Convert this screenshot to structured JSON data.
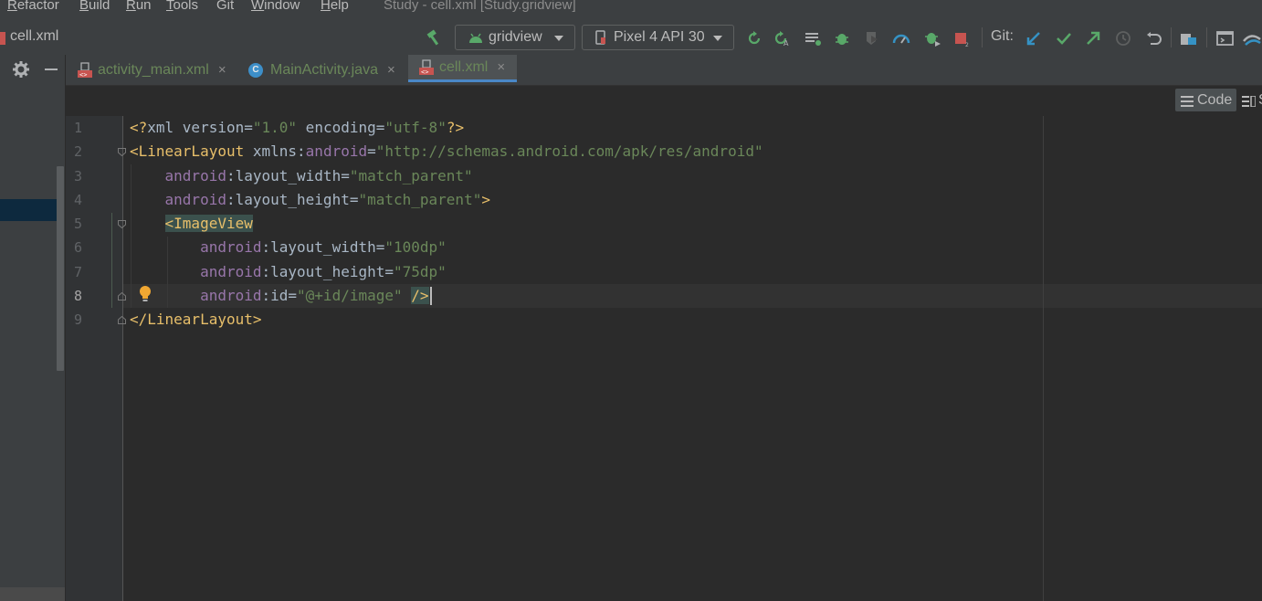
{
  "menu": {
    "items": [
      {
        "underline": "R",
        "rest": "efactor"
      },
      {
        "underline": "B",
        "rest": "uild"
      },
      {
        "underline": "R",
        "rest": "un"
      },
      {
        "underline": "T",
        "rest": "ools"
      },
      {
        "underline": "",
        "rest": "Git"
      },
      {
        "underline": "W",
        "rest": "indow"
      },
      {
        "underline": "H",
        "rest": "elp"
      }
    ],
    "window_title": "Study - cell.xml [Study.gridview]"
  },
  "toolbar": {
    "breadcrumb": "cell.xml",
    "run_config": "gridview",
    "device": "Pixel 4 API 30",
    "git_label": "Git:"
  },
  "tabs": [
    {
      "label": "activity_main.xml",
      "type": "xml",
      "active": false,
      "close": "×"
    },
    {
      "label": "MainActivity.java",
      "type": "java",
      "active": false,
      "close": "×"
    },
    {
      "label": "cell.xml",
      "type": "xml",
      "active": true,
      "close": "×"
    }
  ],
  "view_modes": {
    "code": "Code",
    "split": "S"
  },
  "editor": {
    "line_numbers": [
      "1",
      "2",
      "3",
      "4",
      "5",
      "6",
      "7",
      "8",
      "9"
    ],
    "current_line": 8,
    "lines": [
      [
        [
          "t-tag",
          "<?"
        ],
        [
          "t-plain",
          "xml version"
        ],
        [
          "t-plain",
          "="
        ],
        [
          "t-val",
          "\"1.0\""
        ],
        [
          "t-plain",
          " encoding"
        ],
        [
          "t-plain",
          "="
        ],
        [
          "t-val",
          "\"utf-8\""
        ],
        [
          "t-tag",
          "?>"
        ]
      ],
      [
        [
          "t-tag",
          "<LinearLayout"
        ],
        [
          "t-plain",
          " xmlns"
        ],
        [
          "t-plain",
          ":"
        ],
        [
          "t-ns",
          "android"
        ],
        [
          "t-plain",
          "="
        ],
        [
          "t-val",
          "\"http://schemas.android.com/apk/res/android\""
        ]
      ],
      [
        [
          "t-plain",
          "    "
        ],
        [
          "t-ns",
          "android"
        ],
        [
          "t-plain",
          ":layout_width="
        ],
        [
          "t-val",
          "\"match_parent\""
        ]
      ],
      [
        [
          "t-plain",
          "    "
        ],
        [
          "t-ns",
          "android"
        ],
        [
          "t-plain",
          ":layout_height="
        ],
        [
          "t-val",
          "\"match_parent\""
        ],
        [
          "t-tag",
          ">"
        ]
      ],
      [
        [
          "t-plain",
          "    "
        ],
        [
          "t-tag t-hl",
          "<ImageView"
        ]
      ],
      [
        [
          "t-plain",
          "        "
        ],
        [
          "t-ns",
          "android"
        ],
        [
          "t-plain",
          ":layout_width="
        ],
        [
          "t-val",
          "\"100dp\""
        ]
      ],
      [
        [
          "t-plain",
          "        "
        ],
        [
          "t-ns",
          "android"
        ],
        [
          "t-plain",
          ":layout_height="
        ],
        [
          "t-val",
          "\"75dp\""
        ]
      ],
      [
        [
          "t-plain",
          "        "
        ],
        [
          "t-ns",
          "android"
        ],
        [
          "t-plain",
          ":id="
        ],
        [
          "t-val",
          "\"@+id/image\""
        ],
        [
          "t-plain",
          " "
        ],
        [
          "t-tag t-hl2",
          "/>"
        ]
      ],
      [
        [
          "t-tag",
          "</LinearLayout>"
        ]
      ]
    ]
  },
  "colors": {
    "accent_blue": "#4a88c7",
    "run_green": "#59a869",
    "stop_red": "#c75450"
  },
  "icons": [
    "hammer-icon",
    "android-icon",
    "device-icon",
    "rerun-icon",
    "apply-changes-icon",
    "sync-icon",
    "debug-icon",
    "coverage-icon",
    "profile-icon",
    "attach-debugger-icon",
    "stop-icon",
    "git-update-icon",
    "git-commit-icon",
    "git-push-icon",
    "git-history-icon",
    "git-rollback-icon",
    "project-structure-icon",
    "terminal-icon",
    "sdk-icon",
    "gear-icon",
    "minimize-icon",
    "lightbulb-icon"
  ]
}
